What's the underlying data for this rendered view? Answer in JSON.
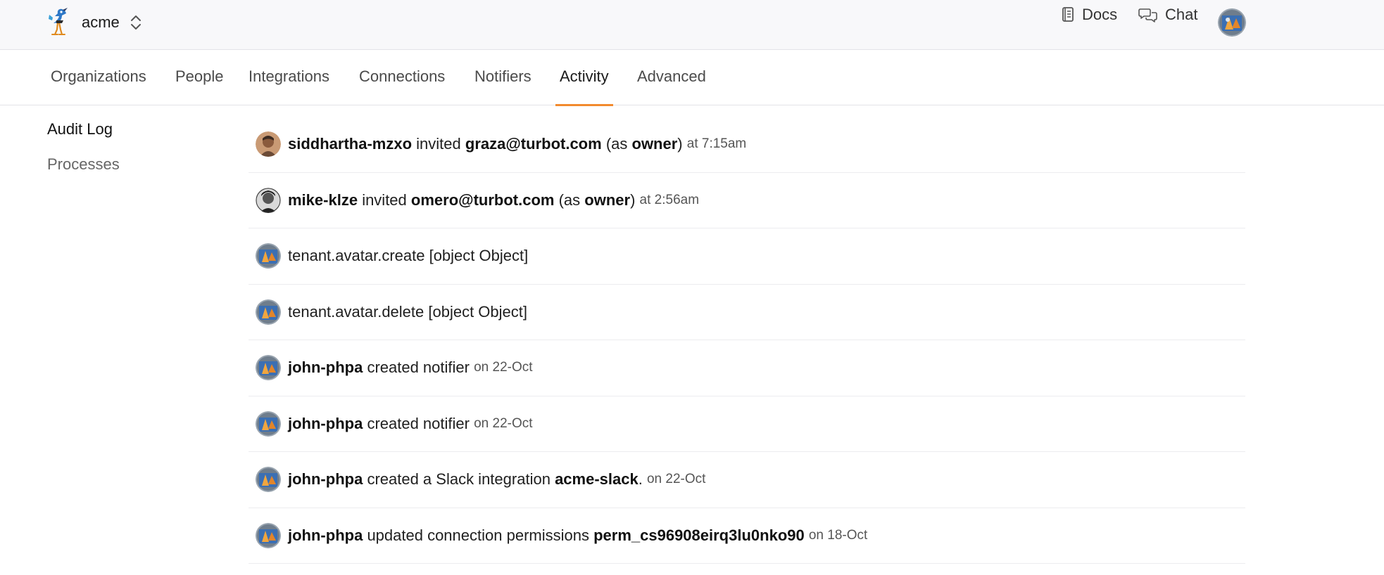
{
  "app": {
    "org_name": "acme",
    "brand_color": "#f28a2e"
  },
  "topbar": {
    "docs_label": "Docs",
    "chat_label": "Chat",
    "icons": [
      "book-icon",
      "chat-bubbles-icon",
      "user-avatar"
    ]
  },
  "tabs": [
    {
      "label": "Organizations",
      "active": false
    },
    {
      "label": "People",
      "active": false
    },
    {
      "label": "Integrations",
      "active": false
    },
    {
      "label": "Connections",
      "active": false
    },
    {
      "label": "Notifiers",
      "active": false
    },
    {
      "label": "Activity",
      "active": true
    },
    {
      "label": "Advanced",
      "active": false
    }
  ],
  "sidenav": {
    "items": [
      {
        "label": "Audit Log",
        "active": true
      },
      {
        "label": "Processes",
        "active": false
      }
    ]
  },
  "activity": {
    "rows": [
      {
        "actor": "siddhartha-mzxo",
        "verb": "invited",
        "target": "graza@turbot.com",
        "as_prefix": "(as",
        "role": "owner",
        "as_suffix": ")",
        "time": "at 7:15am"
      },
      {
        "actor": "mike-klze",
        "verb": "invited",
        "target": "omero@turbot.com",
        "as_prefix": "(as",
        "role": "owner",
        "as_suffix": ")",
        "time": "at 2:56am"
      },
      {
        "text": "tenant.avatar.create [object Object]"
      },
      {
        "text": "tenant.avatar.delete [object Object]"
      },
      {
        "actor": "john-phpa",
        "verb": "created notifier",
        "time": "on 22-Oct"
      },
      {
        "actor": "john-phpa",
        "verb": "created notifier",
        "time": "on 22-Oct"
      },
      {
        "actor": "john-phpa",
        "verb": "created a Slack integration",
        "target": "acme-slack",
        "punct": ".",
        "time": "on 22-Oct"
      },
      {
        "actor": "john-phpa",
        "verb": "updated connection permissions",
        "target": "perm_cs96908eirq3lu0nko90",
        "time": "on 18-Oct"
      }
    ]
  }
}
